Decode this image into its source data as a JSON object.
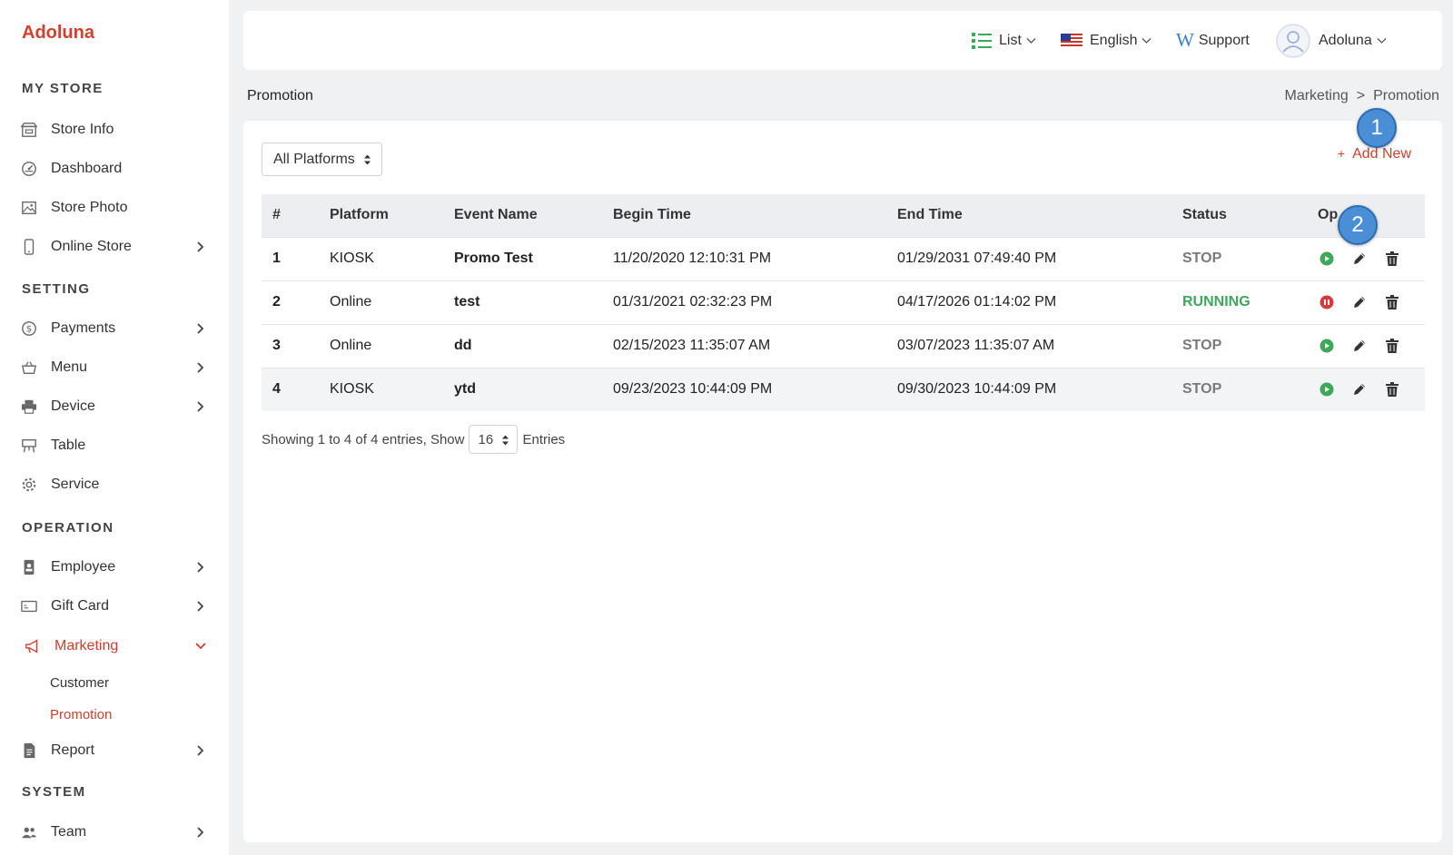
{
  "brand": "Adoluna",
  "sidebar": {
    "sections": [
      {
        "title": "MY STORE"
      },
      {
        "title": "SETTING"
      },
      {
        "title": "OPERATION"
      },
      {
        "title": "SYSTEM"
      }
    ],
    "items": [
      {
        "label": "Store Info",
        "icon": "store-icon"
      },
      {
        "label": "Dashboard",
        "icon": "dashboard-icon"
      },
      {
        "label": "Store Photo",
        "icon": "photo-icon"
      },
      {
        "label": "Online Store",
        "icon": "phone-icon"
      },
      {
        "label": "Payments",
        "icon": "dollar-icon"
      },
      {
        "label": "Menu",
        "icon": "basket-icon"
      },
      {
        "label": "Device",
        "icon": "printer-icon"
      },
      {
        "label": "Table",
        "icon": "table-icon"
      },
      {
        "label": "Service",
        "icon": "gear-icon"
      },
      {
        "label": "Employee",
        "icon": "badge-icon"
      },
      {
        "label": "Gift Card",
        "icon": "giftcard-icon"
      },
      {
        "label": "Marketing",
        "icon": "megaphone-icon"
      },
      {
        "label": "Report",
        "icon": "report-icon"
      },
      {
        "label": "Team",
        "icon": "team-icon"
      }
    ],
    "sub_items": [
      {
        "label": "Customer"
      },
      {
        "label": "Promotion"
      }
    ]
  },
  "topbar": {
    "list_label": "List",
    "language_label": "English",
    "support_label": "Support",
    "user_label": "Adoluna"
  },
  "page": {
    "title": "Promotion",
    "breadcrumb": [
      "Marketing",
      ">",
      "Promotion"
    ]
  },
  "filter": {
    "platform_selected": "All Platforms"
  },
  "add_new_label": "Add New",
  "table": {
    "headers": [
      "#",
      "Platform",
      "Event Name",
      "Begin Time",
      "End Time",
      "Status",
      "Op"
    ],
    "rows": [
      {
        "num": "1",
        "platform": "KIOSK",
        "event": "Promo Test",
        "begin": "11/20/2020 12:10:31 PM",
        "end": "01/29/2031 07:49:40 PM",
        "status": "STOP"
      },
      {
        "num": "2",
        "platform": "Online",
        "event": "test",
        "begin": "01/31/2021 02:32:23 PM",
        "end": "04/17/2026 01:14:02 PM",
        "status": "RUNNING"
      },
      {
        "num": "3",
        "platform": "Online",
        "event": "dd",
        "begin": "02/15/2023 11:35:07 AM",
        "end": "03/07/2023 11:35:07 AM",
        "status": "STOP"
      },
      {
        "num": "4",
        "platform": "KIOSK",
        "event": "ytd",
        "begin": "09/23/2023 10:44:09 PM",
        "end": "09/30/2023 10:44:09 PM",
        "status": "STOP"
      }
    ]
  },
  "pagination": {
    "showing_text": "Showing 1 to 4 of 4 entries, Show",
    "page_size": "16",
    "entries_text": "Entries"
  },
  "markers": [
    "1",
    "2"
  ],
  "colors": {
    "accent": "#c9412e",
    "running": "#3da85a",
    "stop": "#7a7a7a",
    "marker": "#4a8fd6"
  }
}
